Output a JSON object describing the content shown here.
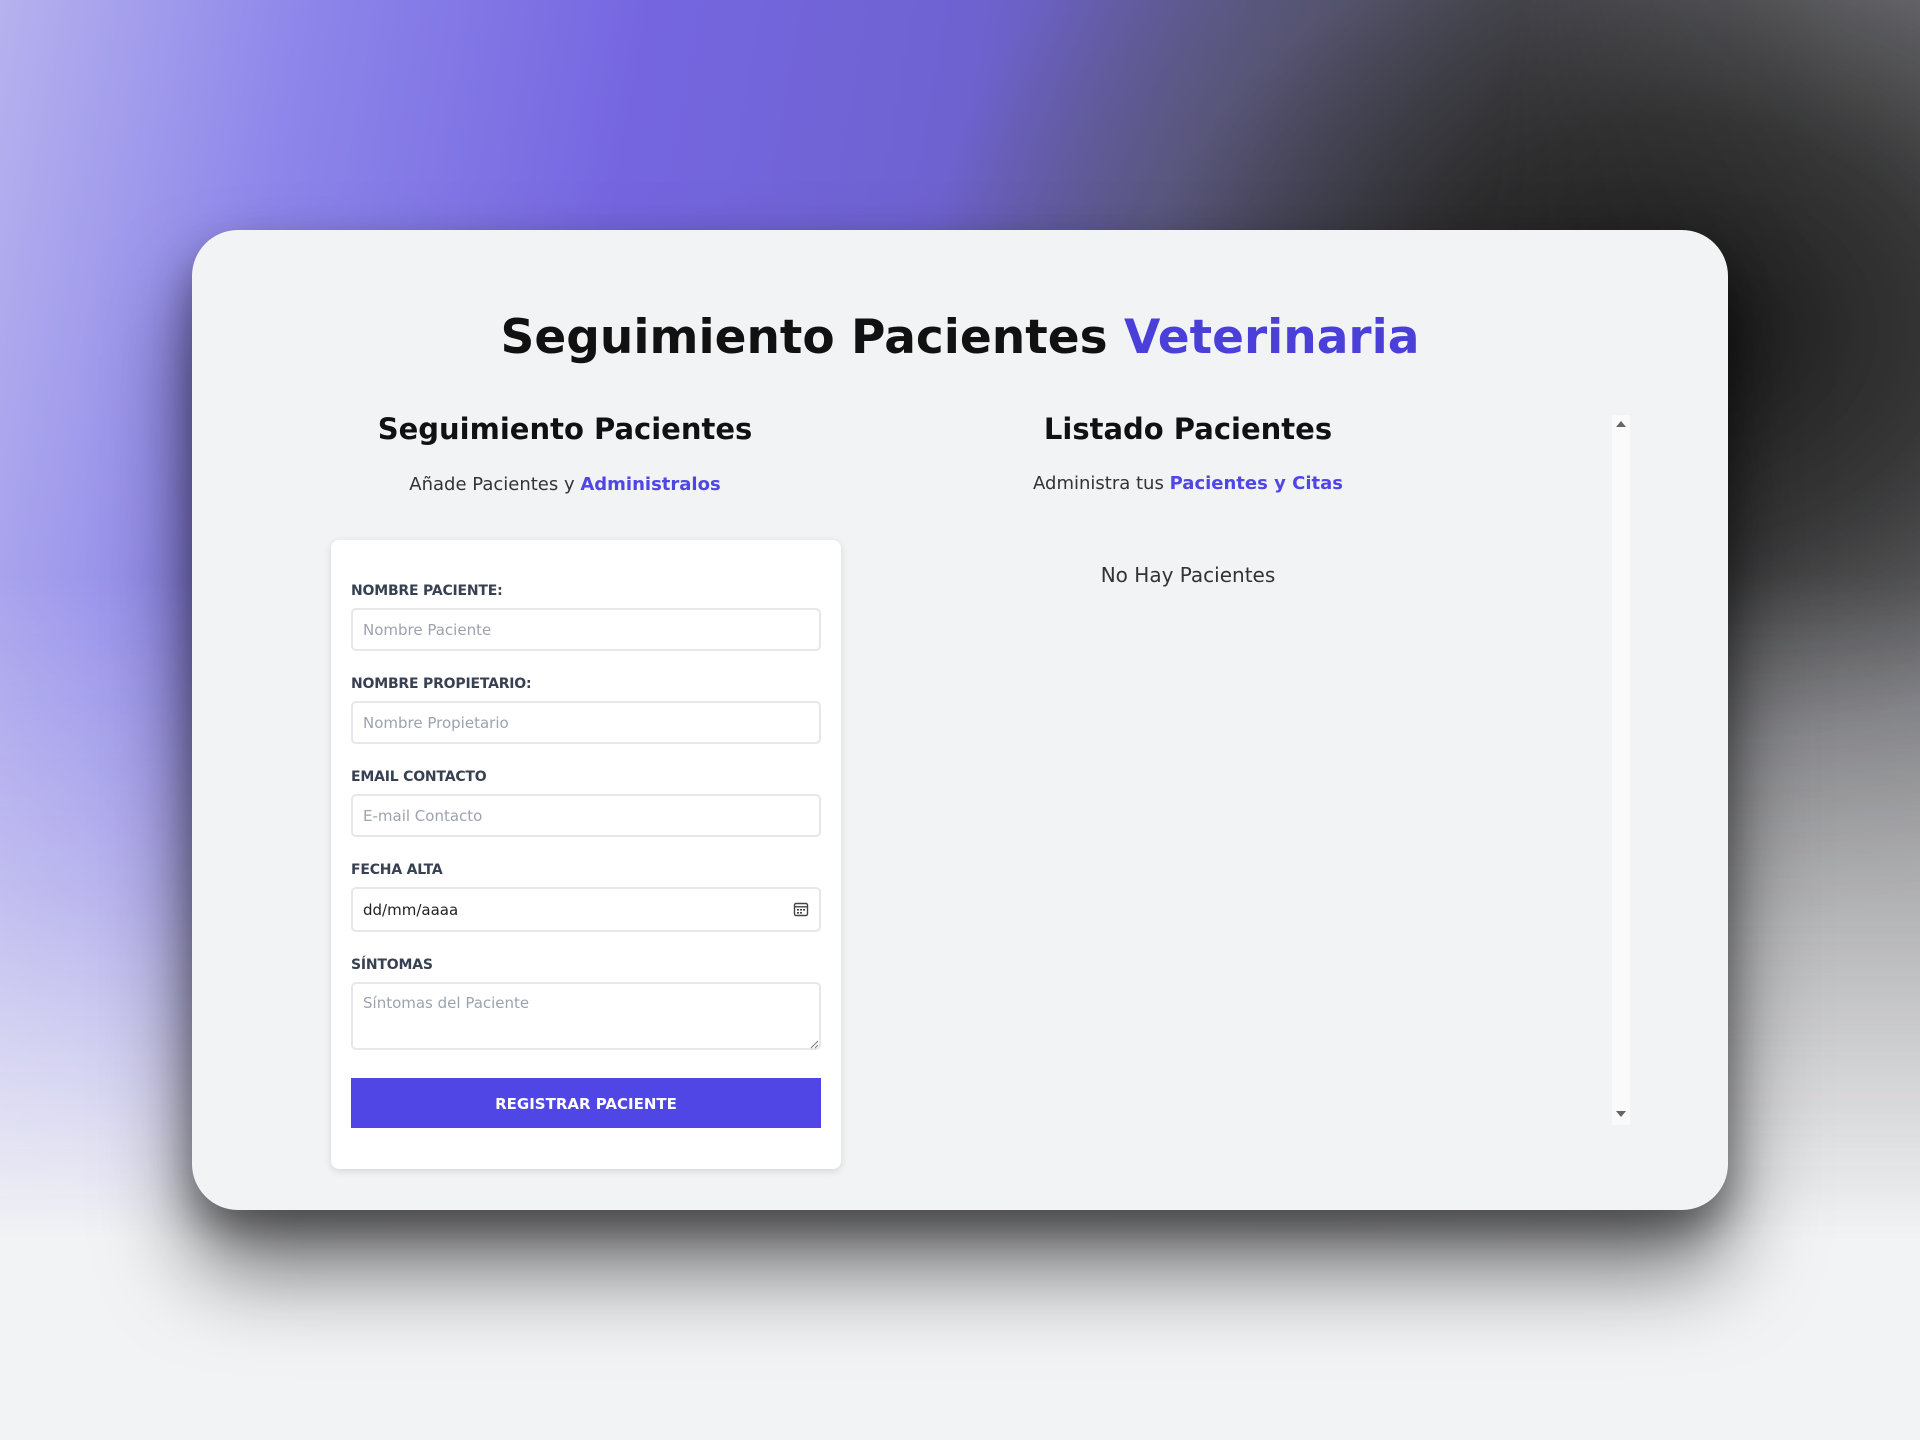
{
  "header": {
    "title_main": "Seguimiento Pacientes",
    "title_accent": "Veterinaria"
  },
  "form_section": {
    "title": "Seguimiento Pacientes",
    "subtitle_prefix": "Añade Pacientes y",
    "subtitle_highlight": "Administralos"
  },
  "list_section": {
    "title": "Listado Pacientes",
    "subtitle_prefix": "Administra tus",
    "subtitle_highlight": "Pacientes y Citas",
    "empty_message": "No Hay Pacientes"
  },
  "form": {
    "pet_name": {
      "label": "NOMBRE PACIENTE:",
      "placeholder": "Nombre Paciente",
      "value": ""
    },
    "owner_name": {
      "label": "NOMBRE PROPIETARIO:",
      "placeholder": "Nombre Propietario",
      "value": ""
    },
    "email": {
      "label": "EMAIL CONTACTO",
      "placeholder": "E-mail Contacto",
      "value": ""
    },
    "date": {
      "label": "FECHA ALTA",
      "value": "dd/mm/aaaa"
    },
    "symptoms": {
      "label": "SÍNTOMAS",
      "placeholder": "Síntomas del Paciente",
      "value": ""
    },
    "submit_label": "REGISTRAR PACIENTE"
  },
  "icons": {
    "calendar": "calendar-icon",
    "scroll_up": "chevron-up-icon",
    "scroll_down": "chevron-down-icon"
  },
  "colors": {
    "accent": "#4a3fd8",
    "button": "#4f46e5",
    "highlight_text": "#4f46e5"
  }
}
